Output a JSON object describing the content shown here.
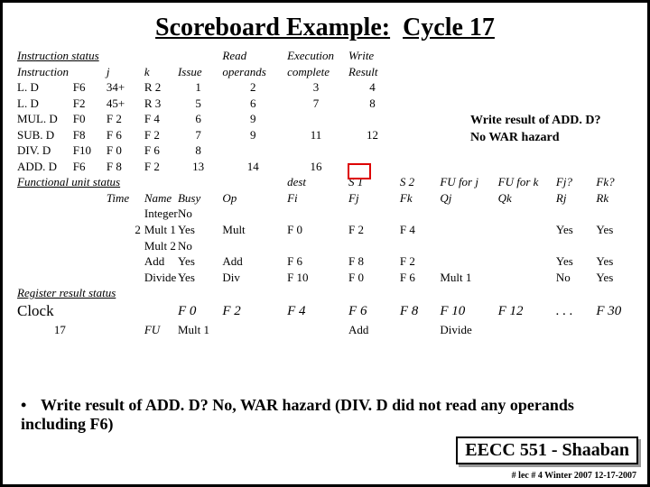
{
  "title_part1": "Scoreboard Example:",
  "title_part2": "Cycle 17",
  "headers": {
    "instr_status": "Instruction status",
    "instruction": "Instruction",
    "j": "j",
    "k": "k",
    "issue": "Issue",
    "read": "Read",
    "operands": "operands",
    "execution": "Execution",
    "complete": "complete",
    "write": "Write",
    "result": "Result",
    "func_unit": "Functional unit status",
    "time": "Time",
    "name": "Name",
    "busy": "Busy",
    "op": "Op",
    "dest": "dest",
    "fi": "Fi",
    "s1": "S 1",
    "fj": "Fj",
    "s2": "S 2",
    "fk": "Fk",
    "fuj": "FU for j",
    "qj": "Qj",
    "fuk": "FU for k",
    "qk": "Qk",
    "fjq": "Fj?",
    "rj": "Rj",
    "fkq": "Fk?",
    "rk": "Rk",
    "reg_status": "Register result status",
    "clock": "Clock",
    "fu": "FU"
  },
  "instructions": [
    {
      "op": "L. D",
      "d": "F6",
      "j": "34+",
      "k": "R 2",
      "issue": "1",
      "read": "2",
      "exec": "3",
      "write": "4"
    },
    {
      "op": "L. D",
      "d": "F2",
      "j": "45+",
      "k": "R 3",
      "issue": "5",
      "read": "6",
      "exec": "7",
      "write": "8"
    },
    {
      "op": "MUL. D",
      "d": "F0",
      "j": "F 2",
      "k": "F 4",
      "issue": "6",
      "read": "9",
      "exec": "",
      "write": ""
    },
    {
      "op": "SUB. D",
      "d": "F8",
      "j": "F 6",
      "k": "F 2",
      "issue": "7",
      "read": "9",
      "exec": "11",
      "write": "12"
    },
    {
      "op": "DIV. D",
      "d": "F10",
      "j": "F 0",
      "k": "F 6",
      "issue": "8",
      "read": "",
      "exec": "",
      "write": ""
    },
    {
      "op": "ADD. D",
      "d": "F6",
      "j": "F 8",
      "k": "F 2",
      "issue": "13",
      "read": "14",
      "exec": "16",
      "write": ""
    }
  ],
  "fus": [
    {
      "time": "",
      "name": "Integer",
      "busy": "No",
      "op": "",
      "fi": "",
      "fj": "",
      "fk": "",
      "qj": "",
      "qk": "",
      "rj": "",
      "rk": ""
    },
    {
      "time": "2",
      "name": "Mult 1",
      "busy": "Yes",
      "op": "Mult",
      "fi": "F 0",
      "fj": "F 2",
      "fk": "F 4",
      "qj": "",
      "qk": "",
      "rj": "Yes",
      "rk": "Yes"
    },
    {
      "time": "",
      "name": "Mult 2",
      "busy": "No",
      "op": "",
      "fi": "",
      "fj": "",
      "fk": "",
      "qj": "",
      "qk": "",
      "rj": "",
      "rk": ""
    },
    {
      "time": "",
      "name": "Add",
      "busy": "Yes",
      "op": "Add",
      "fi": "F 6",
      "fj": "F 8",
      "fk": "F 2",
      "qj": "",
      "qk": "",
      "rj": "Yes",
      "rk": "Yes"
    },
    {
      "time": "",
      "name": "Divide",
      "busy": "Yes",
      "op": "Div",
      "fi": "F 10",
      "fj": "F 0",
      "fk": "F 6",
      "qj": "Mult 1",
      "qk": "",
      "rj": "No",
      "rk": "Yes"
    }
  ],
  "clock_val": "17",
  "regs": {
    "F0": "F 0",
    "F2": "F 2",
    "F4": "F 4",
    "F6": "F 6",
    "F8": "F 8",
    "F10": "F 10",
    "F12": "F 12",
    "dots": ". . .",
    "F30": "F 30"
  },
  "reg_fu": {
    "F0": "Mult 1",
    "F6": "Add",
    "F10": "Divide"
  },
  "note_l1": "Write result of ADD. D?",
  "note_l2": "No WAR hazard",
  "bullet": "Write result of ADD. D?   No, WAR hazard (DIV. D did not read any operands including F6)",
  "signature": "EECC 551 - Shaaban",
  "footer": "#  lec # 4  Winter 2007   12-17-2007"
}
